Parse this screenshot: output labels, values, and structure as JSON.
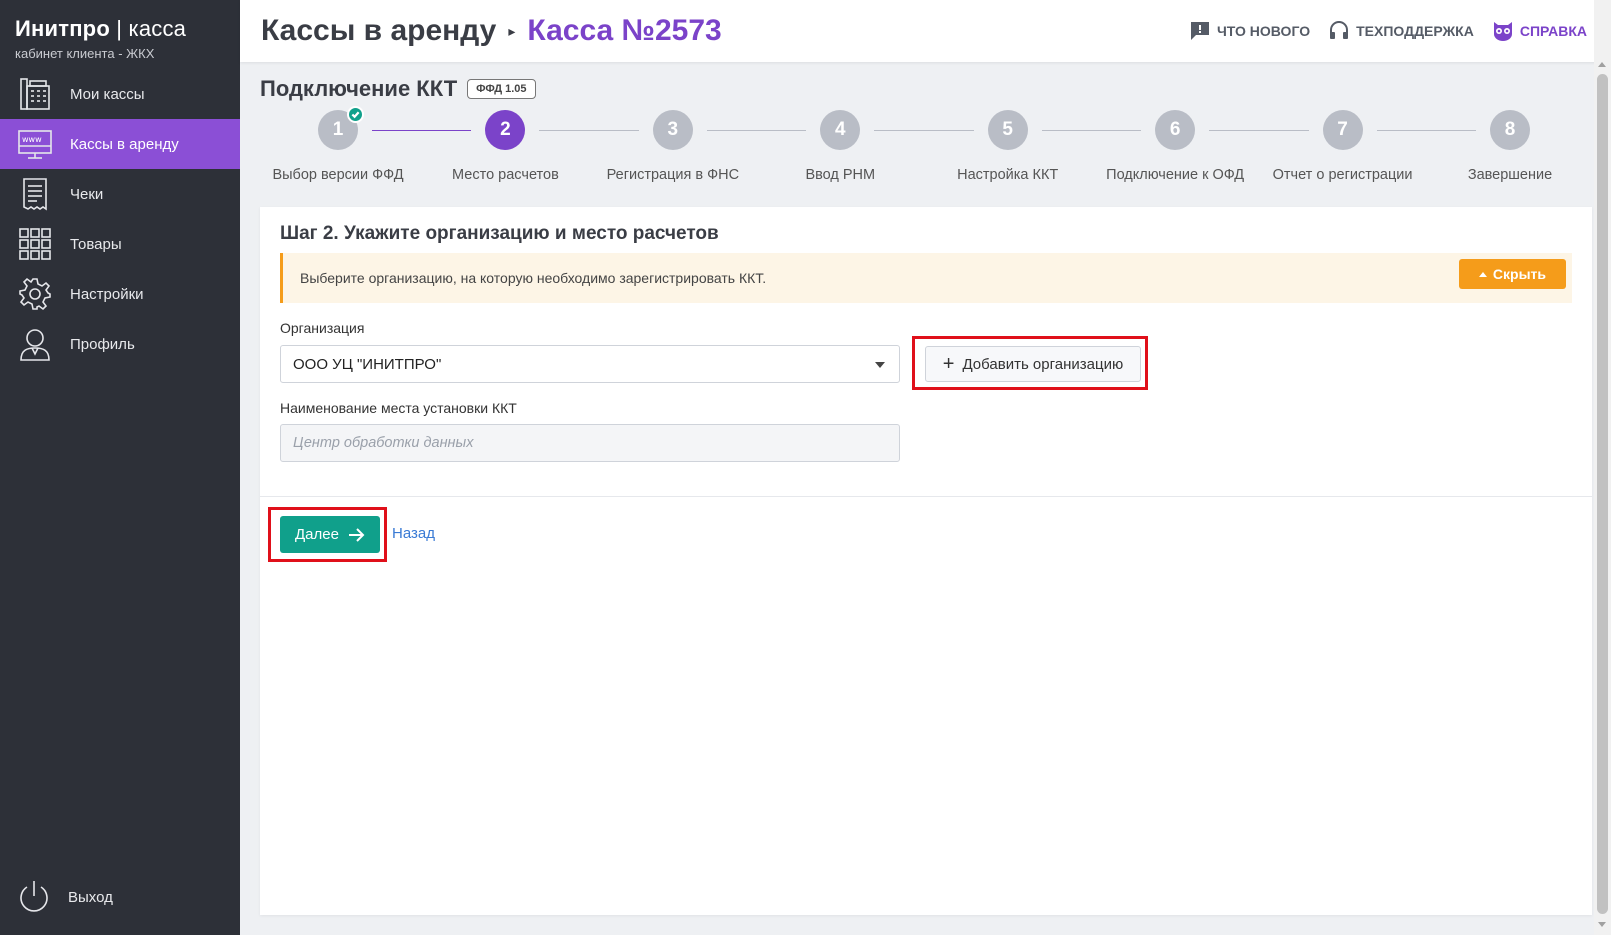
{
  "brand": {
    "title_main": "Инитпро",
    "title_sep": " | ",
    "title_sub": "касса",
    "subtitle": "кабинет клиента - ЖКХ"
  },
  "sidebar": {
    "items": [
      {
        "label": "Мои кассы",
        "icon": "cash-register-icon",
        "active": false
      },
      {
        "label": "Кассы в аренду",
        "icon": "monitor-www-icon",
        "active": true
      },
      {
        "label": "Чеки",
        "icon": "receipt-icon",
        "active": false
      },
      {
        "label": "Товары",
        "icon": "grid-icon",
        "active": false
      },
      {
        "label": "Настройки",
        "icon": "gear-icon",
        "active": false
      },
      {
        "label": "Профиль",
        "icon": "user-icon",
        "active": false
      }
    ],
    "logout": "Выход"
  },
  "header": {
    "breadcrumb_parent": "Кассы в аренду",
    "breadcrumb_current": "Касса №2573",
    "links": {
      "whats_new": "ЧТО НОВОГО",
      "support": "ТЕХПОДДЕРЖКА",
      "help": "СПРАВКА"
    }
  },
  "page": {
    "title": "Подключение ККТ",
    "ffd_badge": "ФФД 1.05"
  },
  "stepper": {
    "current_step": 2,
    "steps": [
      {
        "num": "1",
        "label": "Выбор версии ФФД",
        "done": true
      },
      {
        "num": "2",
        "label": "Место расчетов",
        "done": false
      },
      {
        "num": "3",
        "label": "Регистрация в ФНС",
        "done": false
      },
      {
        "num": "4",
        "label": "Ввод РНМ",
        "done": false
      },
      {
        "num": "5",
        "label": "Настройка ККТ",
        "done": false
      },
      {
        "num": "6",
        "label": "Подключение к ОФД",
        "done": false
      },
      {
        "num": "7",
        "label": "Отчет о регистрации",
        "done": false
      },
      {
        "num": "8",
        "label": "Завершение",
        "done": false
      }
    ]
  },
  "form": {
    "title": "Шаг 2. Укажите организацию и место расчетов",
    "notice": "Выберите организацию, на которую необходимо зарегистрировать ККТ.",
    "hide_label": "Скрыть",
    "org_label": "Организация",
    "org_value": "ООО УЦ \"ИНИТПРО\"",
    "add_org_label": "Добавить организацию",
    "place_label": "Наименование места установки ККТ",
    "place_placeholder": "Центр обработки данных",
    "place_value": "",
    "next_label": "Далее",
    "back_label": "Назад"
  },
  "colors": {
    "sidebar_bg": "#2d3038",
    "accent_purple": "#7b43c9",
    "active_nav": "#8b4fd6",
    "primary_green": "#10a08b",
    "warning_orange": "#f59c1a",
    "highlight_red": "#e0101a"
  }
}
